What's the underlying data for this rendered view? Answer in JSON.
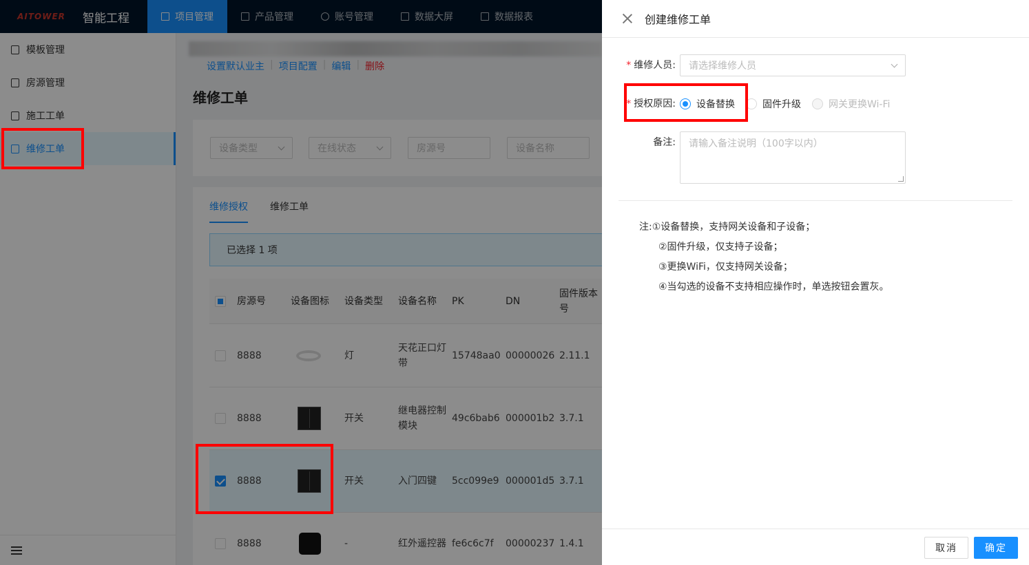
{
  "app": {
    "logo_text": "AITOWER",
    "title": "智能工程"
  },
  "topnav": [
    {
      "label": "项目管理",
      "active": true
    },
    {
      "label": "产品管理",
      "active": false
    },
    {
      "label": "账号管理",
      "active": false
    },
    {
      "label": "数据大屏",
      "active": false
    },
    {
      "label": "数据报表",
      "active": false
    }
  ],
  "sidebar": {
    "items": [
      {
        "label": "模板管理"
      },
      {
        "label": "房源管理"
      },
      {
        "label": "施工工单"
      },
      {
        "label": "维修工单"
      }
    ]
  },
  "main": {
    "links": {
      "set_owner": "设置默认业主",
      "project_config": "项目配置",
      "edit": "编辑",
      "delete": "删除",
      "sep": "|"
    },
    "page_title": "维修工单",
    "filters": {
      "device_type": "设备类型",
      "online_status": "在线状态",
      "room_no": "房源号",
      "device_name": "设备名称"
    },
    "tabs": {
      "auth": "维修授权",
      "orders": "维修工单"
    },
    "alert": "已选择  1  项",
    "table": {
      "headers": [
        "房源号",
        "设备图标",
        "设备类型",
        "设备名称",
        "PK",
        "DN",
        "固件版本号"
      ],
      "rows": [
        {
          "room": "8888",
          "type": "灯",
          "name": "天花正口灯带",
          "pk": "15748aa0",
          "dn": "00000026",
          "fw": "2.11.1"
        },
        {
          "room": "8888",
          "type": "开关",
          "name": "继电器控制模块",
          "pk": "49c6bab6",
          "dn": "000001b2",
          "fw": "3.7.1"
        },
        {
          "room": "8888",
          "type": "开关",
          "name": "入门四键",
          "pk": "5cc099e9",
          "dn": "000001d5",
          "fw": "3.7.1"
        },
        {
          "room": "8888",
          "type": "-",
          "name": "红外遥控器",
          "pk": "fe6c6c7f",
          "dn": "00000237",
          "fw": "1.4.1"
        }
      ]
    }
  },
  "drawer": {
    "title": "创建维修工单",
    "required_mark": "*",
    "repair_person": {
      "label": "维修人员:",
      "placeholder": "请选择维修人员"
    },
    "auth_reason": {
      "label": "授权原因:",
      "options": [
        {
          "label": "设备替换",
          "checked": true,
          "disabled": false
        },
        {
          "label": "固件升级",
          "checked": false,
          "disabled": false
        },
        {
          "label": "网关更换Wi-Fi",
          "checked": false,
          "disabled": true
        }
      ]
    },
    "remark": {
      "label": "备注:",
      "placeholder": "请输入备注说明（100字以内）"
    },
    "notes": {
      "prefix": "注:",
      "lines": [
        "①设备替换，支持网关设备和子设备；",
        "②固件升级，仅支持子设备；",
        "③更换WiFi，仅支持网关设备；",
        "④当勾选的设备不支持相应操作时，单选按钮会置灰。"
      ]
    },
    "cancel": "取消",
    "ok": "确定"
  },
  "colors": {
    "primary": "#1890ff",
    "nav_bg": "#001529",
    "highlight": "#ff0000",
    "danger": "#f5222d"
  }
}
